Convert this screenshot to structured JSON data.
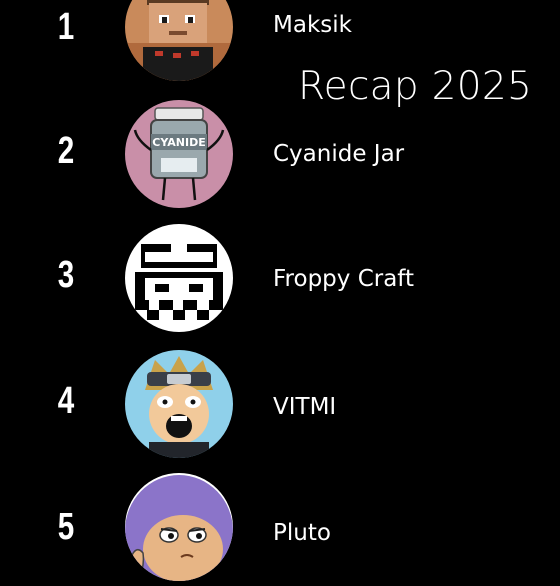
{
  "title": "Recap 2025",
  "entries": [
    {
      "rank": "1",
      "name": "Maksik",
      "avatar_icon": "blocky-character-avatar"
    },
    {
      "rank": "2",
      "name": "Cyanide Jar",
      "avatar_icon": "cyanide-jar-avatar",
      "avatar_text": "CYANIDE"
    },
    {
      "rank": "3",
      "name": "Froppy Craft",
      "avatar_icon": "pixel-face-avatar"
    },
    {
      "rank": "4",
      "name": "VITMI",
      "avatar_icon": "ninja-headband-avatar"
    },
    {
      "rank": "5",
      "name": "Pluto",
      "avatar_icon": "cartoon-purple-hair-avatar"
    }
  ]
}
